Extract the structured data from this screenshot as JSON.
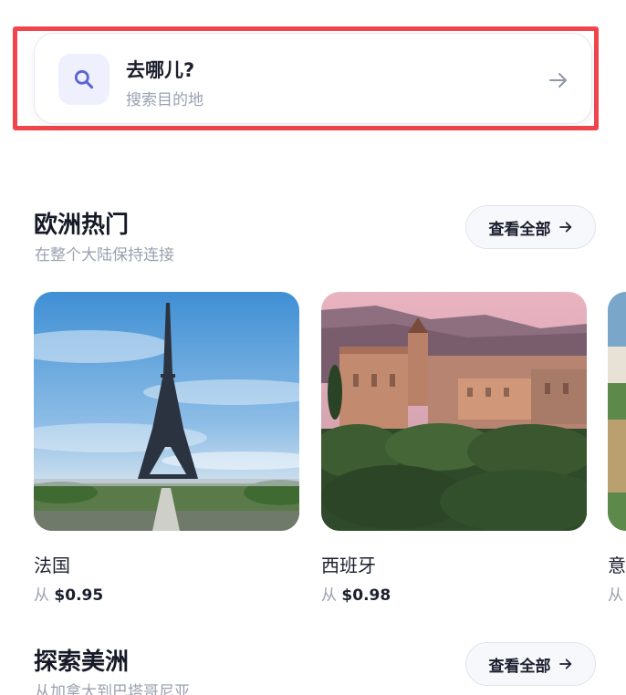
{
  "search": {
    "title": "去哪儿?",
    "subtitle": "搜索目的地",
    "icon": "search-icon",
    "arrow_icon": "arrow-right-icon"
  },
  "sections": [
    {
      "title": "欧洲热门",
      "subtitle": "在整个大陆保持连接",
      "view_all": "查看全部",
      "cards": [
        {
          "name": "法国",
          "price_prefix": "从",
          "price": "$0.95"
        },
        {
          "name": "西班牙",
          "price_prefix": "从",
          "price": "$0.98"
        },
        {
          "name": "意",
          "price_prefix": "从",
          "price": ""
        }
      ]
    },
    {
      "title": "探索美洲",
      "subtitle": "从加拿大到巴塔哥尼亚",
      "view_all": "查看全部"
    }
  ],
  "colors": {
    "highlight": "#f0454d",
    "accent": "#5b63d3",
    "muted": "#9aa1b0"
  }
}
